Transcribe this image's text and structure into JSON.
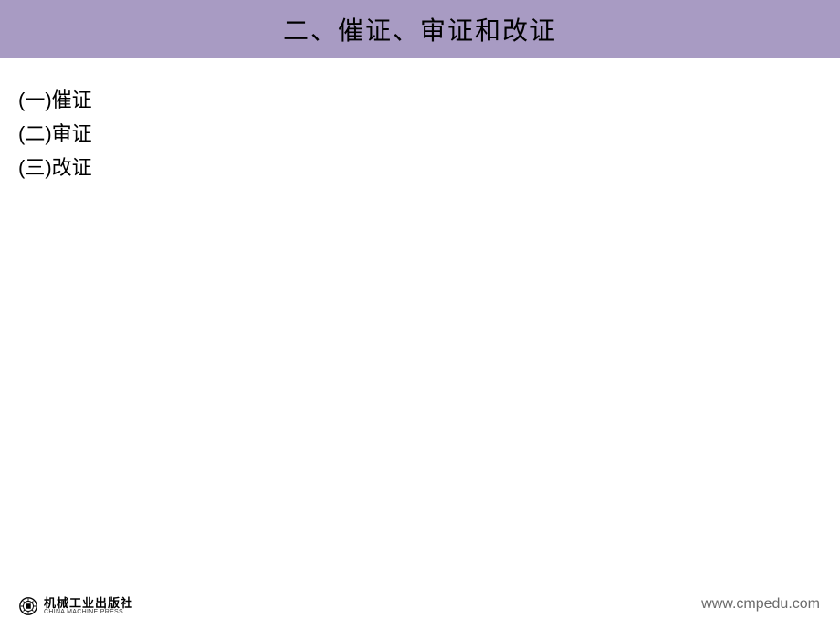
{
  "header": {
    "title": "二、催证、审证和改证"
  },
  "content": {
    "items": [
      "(一)催证",
      "(二)审证",
      "(三)改证"
    ]
  },
  "footer": {
    "publisher_cn": "机械工业出版社",
    "publisher_en": "CHINA MACHINE PRESS",
    "website": "www.cmpedu.com"
  }
}
